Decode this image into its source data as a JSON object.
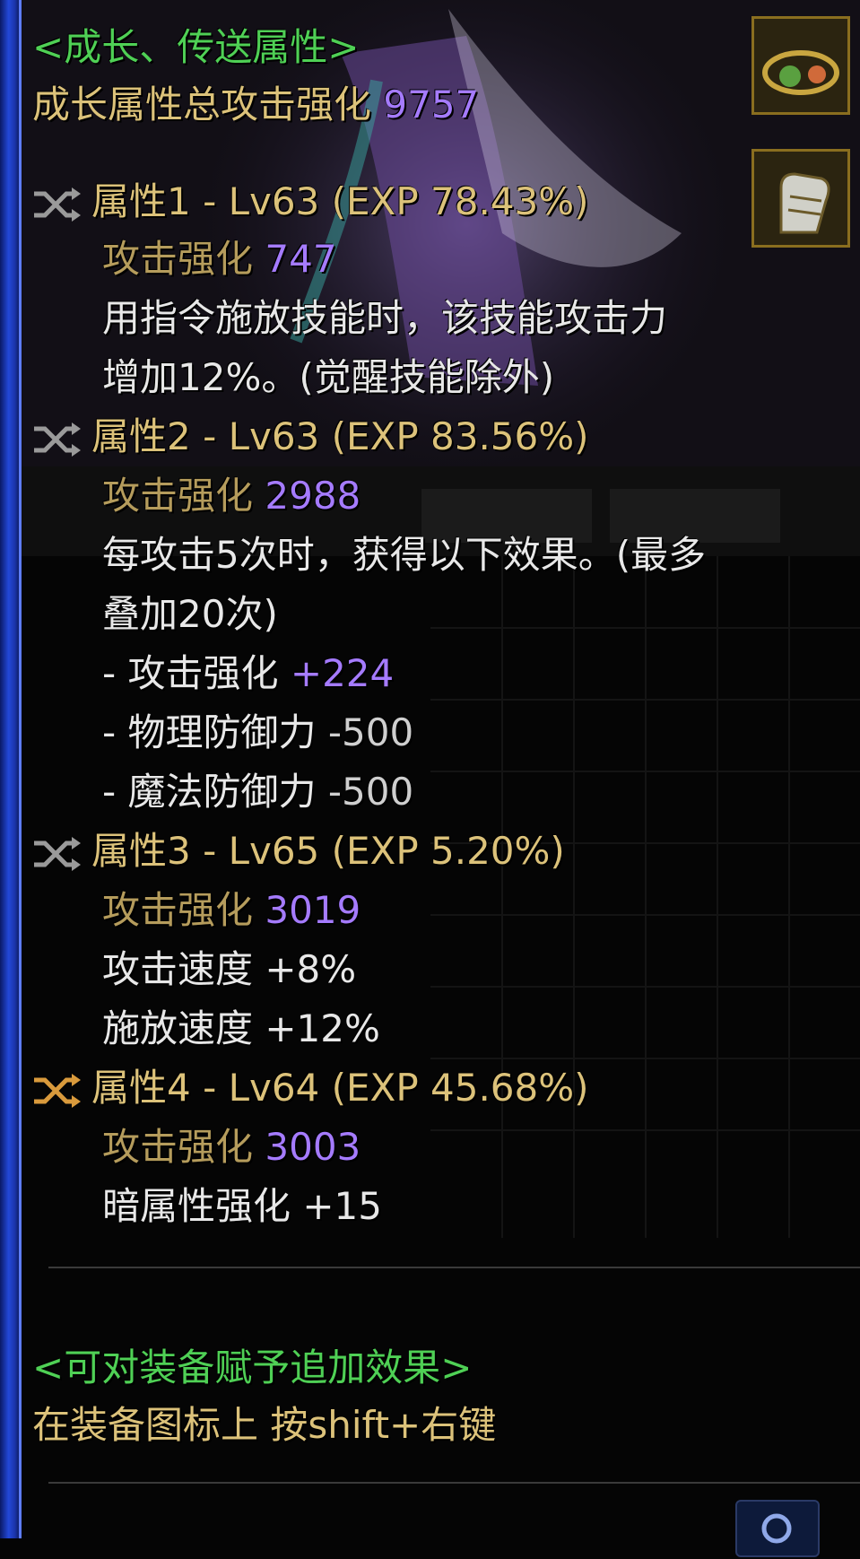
{
  "header": {
    "section_title": "<成长、传送属性>",
    "total_label": "成长属性总攻击强化",
    "total_value": "9757"
  },
  "attributes": [
    {
      "title": "属性1 - Lv63 (EXP 78.43%)",
      "attack_label": "攻击强化",
      "attack_value": "747",
      "desc_lines": [
        "用指令施放技能时，该技能攻击力",
        "增加12%。(觉醒技能除外)"
      ]
    },
    {
      "title": "属性2 - Lv63 (EXP 83.56%)",
      "attack_label": "攻击强化",
      "attack_value": "2988",
      "desc_lines": [
        "每攻击5次时，获得以下效果。(最多",
        "叠加20次)"
      ],
      "effects": [
        {
          "label": "- 攻击强化",
          "value": "+224"
        },
        {
          "label": "- 物理防御力",
          "value": "-500"
        },
        {
          "label": "- 魔法防御力",
          "value": "-500"
        }
      ]
    },
    {
      "title": "属性3 - Lv65 (EXP 5.20%)",
      "attack_label": "攻击强化",
      "attack_value": "3019",
      "stats": [
        "攻击速度 +8%",
        "施放速度 +12%"
      ]
    },
    {
      "title": "属性4 - Lv64 (EXP 45.68%)",
      "attack_label": "攻击强化",
      "attack_value": "3003",
      "stats": [
        "暗属性强化 +15"
      ]
    }
  ],
  "footer": {
    "title": "<可对装备赋予追加效果>",
    "instruction": "在装备图标上 按shift+右键"
  },
  "icons": {
    "shuffle": "shuffle-icon",
    "shuffle_color": "#9a9a9a",
    "shuffle_active_color": "#d99a3c"
  }
}
